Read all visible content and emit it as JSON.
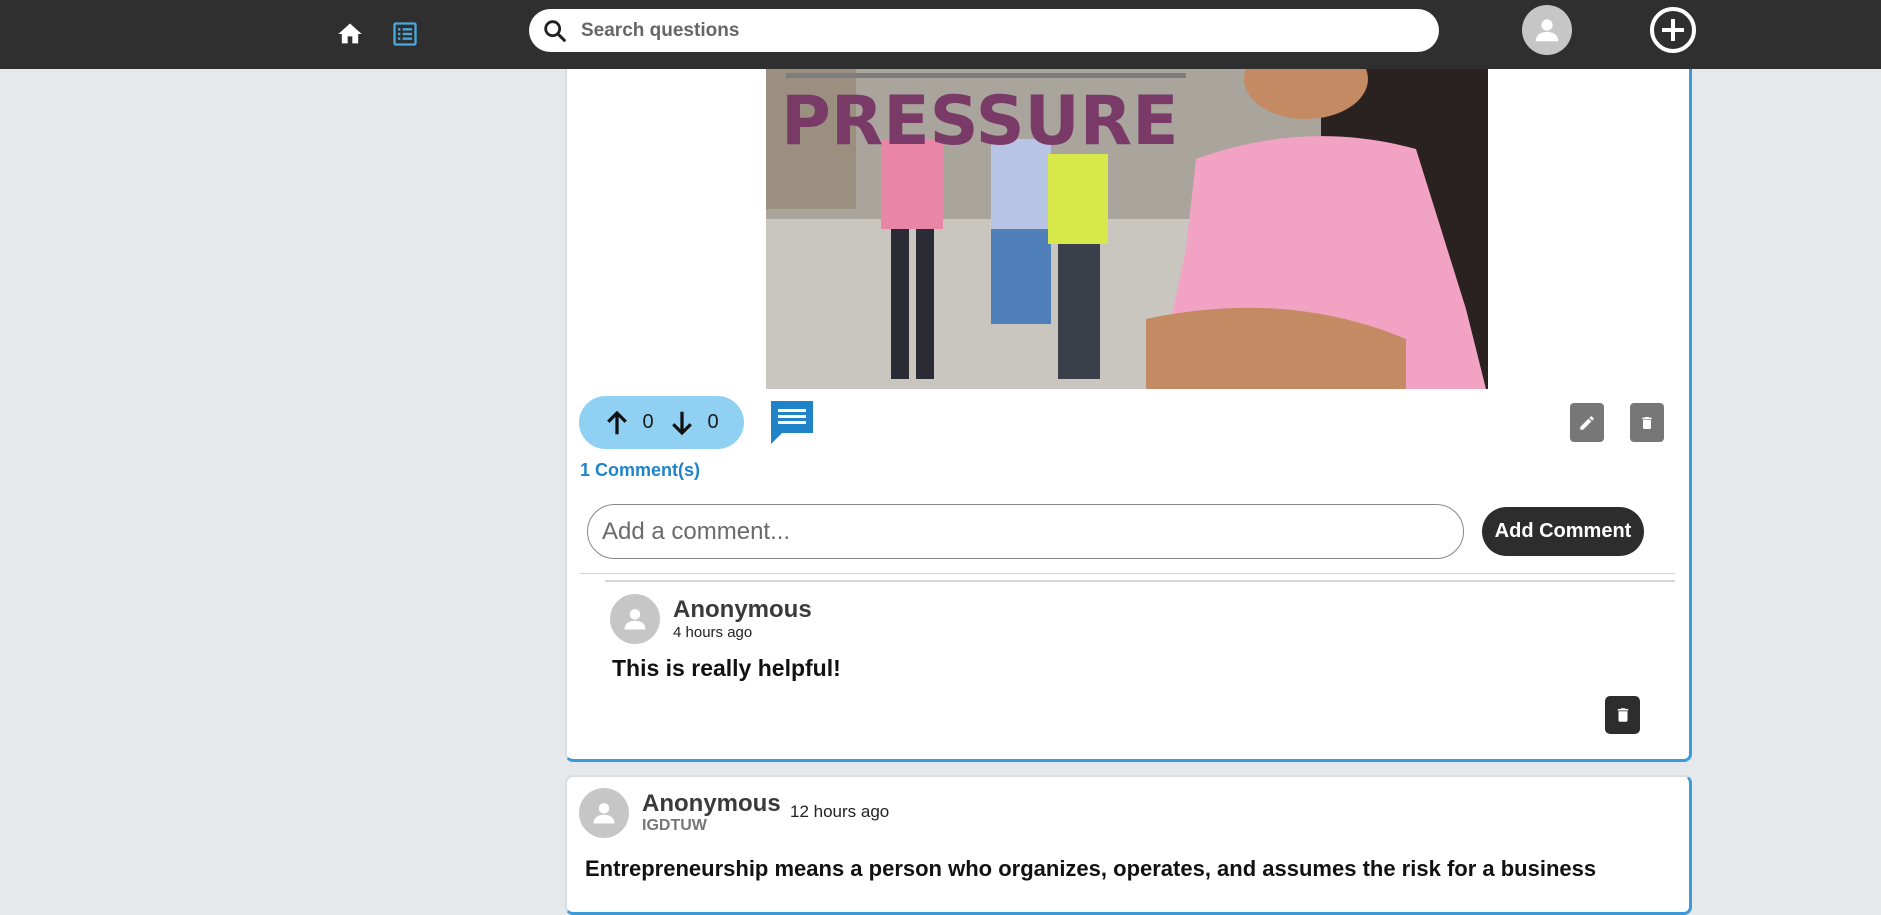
{
  "header": {
    "search_placeholder": "Search questions",
    "icons": [
      "home-icon",
      "feed-list-icon",
      "search-icon",
      "user-avatar-icon",
      "add-circle-icon"
    ]
  },
  "post": {
    "image_text": "PRESSURE",
    "upvotes": "0",
    "downvotes": "0",
    "comments_link": "1 Comment(s)",
    "comment_placeholder": "Add a comment...",
    "add_comment_label": "Add Comment"
  },
  "comment": {
    "author": "Anonymous",
    "time": "4 hours ago",
    "text": "This is really helpful!"
  },
  "next_post": {
    "author": "Anonymous",
    "org": "IGDTUW",
    "time": "12 hours ago",
    "text": "Entrepreneurship means a person who organizes, operates, and assumes the risk for a business"
  },
  "colors": {
    "topbar": "#2f2f2f",
    "accent": "#1f84c7",
    "vote_pill": "#90d1f3",
    "dark_button": "#2d2d2d"
  }
}
